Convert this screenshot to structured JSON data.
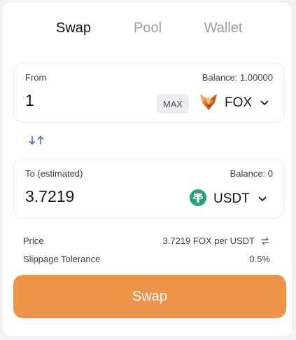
{
  "tabs": [
    {
      "label": "Swap",
      "active": true
    },
    {
      "label": "Pool",
      "active": false
    },
    {
      "label": "Wallet",
      "active": false
    }
  ],
  "from": {
    "label": "From",
    "balance": "Balance: 1.00000",
    "amount": "1",
    "max_label": "MAX",
    "token": "FOX",
    "token_icon": "fox-logo-icon"
  },
  "switch_icon": "swap-arrows-icon",
  "to": {
    "label": "To (estimated)",
    "balance": "Balance: 0",
    "amount": "3.7219",
    "token": "USDT",
    "token_icon": "tether-logo-icon"
  },
  "details": {
    "price_label": "Price",
    "price_value": "3.7219 FOX per USDT",
    "slippage_label": "Slippage Tolerance",
    "slippage_value": "0.5%"
  },
  "swap_button": "Swap",
  "colors": {
    "accent": "#ee9448",
    "tether": "#26a17b",
    "switch_arrows": "#3a6fb5"
  }
}
